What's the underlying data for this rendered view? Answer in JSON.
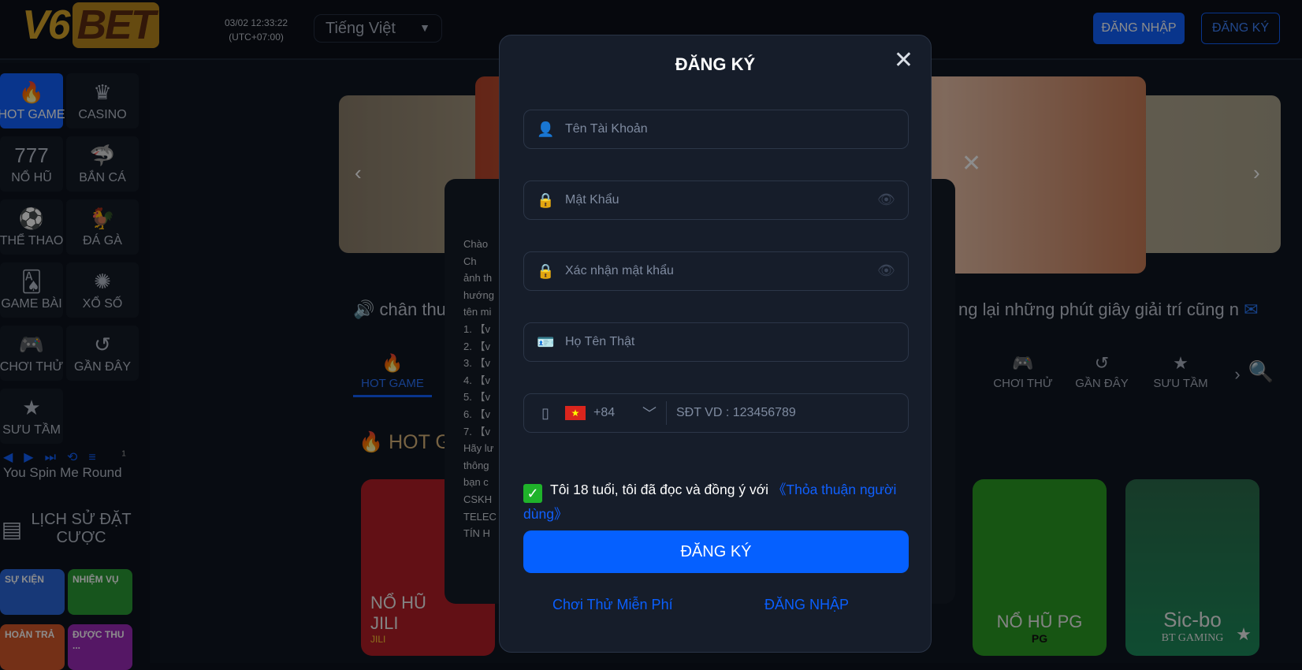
{
  "header": {
    "logo": "V6BET",
    "datetime": "03/02 12:33:22",
    "timezone": "(UTC+07:00)",
    "language": "Tiếng Việt",
    "login": "ĐĂNG NHẬP",
    "register": "ĐĂNG KÝ"
  },
  "sidebar": {
    "items": [
      {
        "label": "HOT GAME",
        "icon": "fire-icon",
        "glyph": "🔥",
        "active": true
      },
      {
        "label": "CASINO",
        "icon": "dealer-icon",
        "glyph": "♛"
      },
      {
        "label": "NỔ HŨ",
        "icon": "slot-icon",
        "glyph": "777"
      },
      {
        "label": "BẮN CÁ",
        "icon": "shark-icon",
        "glyph": "🦈"
      },
      {
        "label": "THỂ THAO",
        "icon": "soccer-icon",
        "glyph": "⚽"
      },
      {
        "label": "ĐÁ GÀ",
        "icon": "rooster-icon",
        "glyph": "🐓"
      },
      {
        "label": "GAME BÀI",
        "icon": "cards-icon",
        "glyph": "🂡"
      },
      {
        "label": "XỔ SỐ",
        "icon": "lottery-icon",
        "glyph": "✺"
      },
      {
        "label": "CHƠI THỬ",
        "icon": "gamepad-icon",
        "glyph": "🎮"
      },
      {
        "label": "GẦN ĐÂY",
        "icon": "history-icon",
        "glyph": "↺"
      },
      {
        "label": "SƯU TẦM",
        "icon": "star-icon",
        "glyph": "★"
      }
    ],
    "music": {
      "title": "You Spin Me Round",
      "count": "1"
    },
    "bet_history": "LỊCH SỬ ĐẶT CƯỢC",
    "promos": [
      "SỰ KIỆN",
      "NHIỆM VỤ",
      "HOÀN TRẢ",
      "ĐƯỢC THU ..."
    ]
  },
  "marquee": {
    "left": "chân thu",
    "right": "ng lại những phút giây giải trí cũng n"
  },
  "tabs": [
    {
      "label": "HOT GAME"
    },
    {
      "label": "CHƠI THỬ"
    },
    {
      "label": "GẦN ĐÂY"
    },
    {
      "label": "SƯU TẦM"
    }
  ],
  "section_title": "HOT G",
  "cards": [
    {
      "title": "NỔ HŨ JILI",
      "brand": "JILI"
    },
    {
      "title": "NỔ HŨ PG",
      "brand": "PG"
    },
    {
      "title": "Sic-bo",
      "brand": "BT GAMING"
    }
  ],
  "notice": {
    "lines": [
      "Chào",
      "Ch",
      "ảnh th",
      "hướng",
      "tên mi",
      "1. 【v",
      "2. 【v",
      "3. 【v",
      "4. 【v",
      "5. 【v",
      "6. 【v",
      "7. 【v",
      "Hãy lư",
      "thông",
      "bạn c",
      "CSKH",
      "TELEC",
      "TÍN H"
    ]
  },
  "modal": {
    "title": "ĐĂNG KÝ",
    "username_placeholder": "Tên Tài Khoản",
    "password_placeholder": "Mật Khẩu",
    "confirm_placeholder": "Xác nhận mật khẩu",
    "fullname_placeholder": "Họ Tên Thật",
    "country_code": "+84",
    "phone_placeholder": "SĐT VD : 123456789",
    "agree_checked": true,
    "agree_text": "Tôi 18 tuổi, tôi đã đọc và đồng ý với",
    "agree_link": "《Thỏa thuận người dùng》",
    "submit": "ĐĂNG KÝ",
    "free_play": "Chơi Thử Miễn Phí",
    "login": "ĐĂNG NHẬP"
  },
  "colors": {
    "accent": "#0560ff",
    "modal_bg": "#161d2a",
    "check": "#1fb32a"
  }
}
